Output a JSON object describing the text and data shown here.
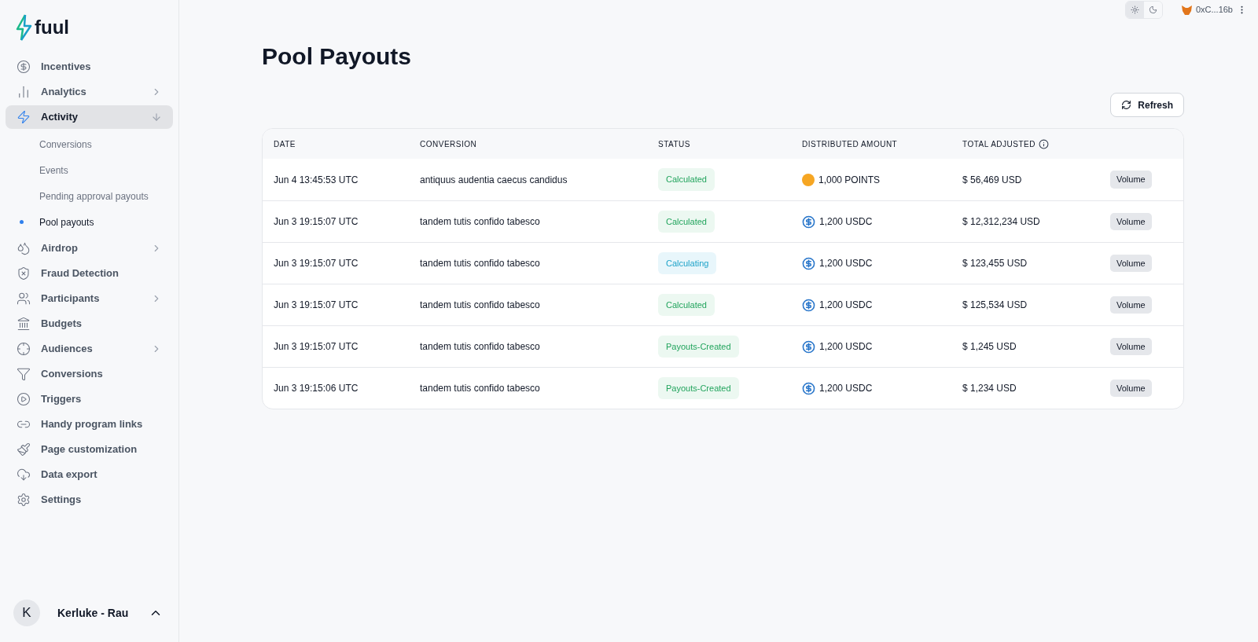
{
  "brand": {
    "name": "fuul"
  },
  "sidebar": {
    "items": [
      {
        "label": "Incentives",
        "kind": "link",
        "selected": false
      },
      {
        "label": "Analytics",
        "kind": "group",
        "selected": false
      },
      {
        "label": "Activity",
        "kind": "open_group",
        "selected": true,
        "children": [
          {
            "label": "Conversions",
            "selected": false
          },
          {
            "label": "Events",
            "selected": false
          },
          {
            "label": "Pending approval payouts",
            "selected": false
          },
          {
            "label": "Pool payouts",
            "selected": true
          }
        ]
      },
      {
        "label": "Airdrop",
        "kind": "group",
        "selected": false
      },
      {
        "label": "Fraud Detection",
        "kind": "link",
        "selected": false
      },
      {
        "label": "Participants",
        "kind": "group",
        "selected": false
      },
      {
        "label": "Budgets",
        "kind": "link",
        "selected": false
      },
      {
        "label": "Audiences",
        "kind": "group",
        "selected": false
      },
      {
        "label": "Conversions",
        "kind": "link",
        "selected": false
      },
      {
        "label": "Triggers",
        "kind": "link",
        "selected": false
      },
      {
        "label": "Handy program links",
        "kind": "link",
        "selected": false
      },
      {
        "label": "Page customization",
        "kind": "link",
        "selected": false
      },
      {
        "label": "Data export",
        "kind": "link",
        "selected": false
      },
      {
        "label": "Settings",
        "kind": "link",
        "selected": false
      }
    ],
    "account": {
      "initial": "K",
      "name": "Kerluke - Rau"
    }
  },
  "topbar": {
    "theme": [
      {
        "kind": "light",
        "selected": true
      },
      {
        "kind": "dark",
        "selected": false
      }
    ],
    "wallet": "0xC...16b"
  },
  "page": {
    "title": "Pool Payouts",
    "refresh": "Refresh"
  },
  "table": {
    "columns": [
      "DATE",
      "CONVERSION",
      "STATUS",
      "DISTRIBUTED AMOUNT",
      "TOTAL ADJUSTED"
    ],
    "rows": [
      {
        "date": "Jun 4 13:45:53 UTC",
        "conversion": "antiquus audentia caecus candidus",
        "status": {
          "label": "Calculated",
          "kind": "done"
        },
        "amount": {
          "kind": "points",
          "text": "1,000 POINTS"
        },
        "total": "$ 56,469 USD",
        "tag": "Volume"
      },
      {
        "date": "Jun 3 19:15:07 UTC",
        "conversion": "tandem tutis confido tabesco",
        "status": {
          "label": "Calculated",
          "kind": "done"
        },
        "amount": {
          "kind": "usdc",
          "text": "1,200 USDC"
        },
        "total": "$ 12,312,234 USD",
        "tag": "Volume"
      },
      {
        "date": "Jun 3 19:15:07 UTC",
        "conversion": "tandem tutis confido tabesco",
        "status": {
          "label": "Calculating",
          "kind": "pending"
        },
        "amount": {
          "kind": "usdc",
          "text": "1,200 USDC"
        },
        "total": "$ 123,455 USD",
        "tag": "Volume"
      },
      {
        "date": "Jun 3 19:15:07 UTC",
        "conversion": "tandem tutis confido tabesco",
        "status": {
          "label": "Calculated",
          "kind": "done"
        },
        "amount": {
          "kind": "usdc",
          "text": "1,200 USDC"
        },
        "total": "$ 125,534 USD",
        "tag": "Volume"
      },
      {
        "date": "Jun 3 19:15:07 UTC",
        "conversion": "tandem tutis confido tabesco",
        "status": {
          "label": "Payouts-Created",
          "kind": "done"
        },
        "amount": {
          "kind": "usdc",
          "text": "1,200 USDC"
        },
        "total": "$ 1,245 USD",
        "tag": "Volume"
      },
      {
        "date": "Jun 3 19:15:06 UTC",
        "conversion": "tandem tutis confido tabesco",
        "status": {
          "label": "Payouts-Created",
          "kind": "done"
        },
        "amount": {
          "kind": "usdc",
          "text": "1,200 USDC"
        },
        "total": "$ 1,234 USD",
        "tag": "Volume"
      }
    ]
  }
}
